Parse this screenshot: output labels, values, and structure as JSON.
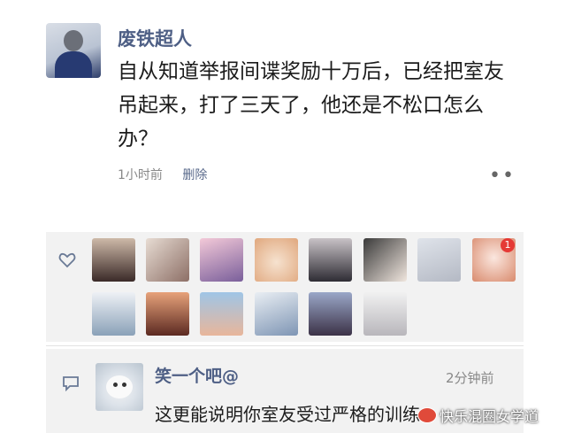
{
  "post": {
    "username": "废铁超人",
    "text": "自从知道举报间谍奖励十万后，已经把室友吊起来，打了三天了，他还是不松口怎么办？",
    "time": "1小时前",
    "delete_label": "删除",
    "more_label": "••"
  },
  "likes": {
    "badge_count": "1",
    "avatars": [
      {
        "icon": "avatar-photo-1"
      },
      {
        "icon": "avatar-photo-2"
      },
      {
        "icon": "avatar-photo-3"
      },
      {
        "icon": "avatar-photo-4"
      },
      {
        "icon": "avatar-photo-5"
      },
      {
        "icon": "avatar-photo-6"
      },
      {
        "icon": "avatar-photo-7"
      },
      {
        "icon": "avatar-photo-8"
      },
      {
        "icon": "avatar-photo-9"
      },
      {
        "icon": "avatar-photo-10"
      },
      {
        "icon": "avatar-photo-11"
      },
      {
        "icon": "avatar-photo-12"
      },
      {
        "icon": "avatar-photo-13"
      },
      {
        "icon": "avatar-photo-14"
      }
    ]
  },
  "comment": {
    "username": "笑一个吧@",
    "time": "2分钟前",
    "text": "这更能说明你室友受过严格的训练"
  },
  "watermark": {
    "text": "快乐混圈女学道"
  },
  "colors": {
    "name_blue": "#4e5f85",
    "panel_gray": "#f2f2f2",
    "badge_red": "#e53935"
  }
}
